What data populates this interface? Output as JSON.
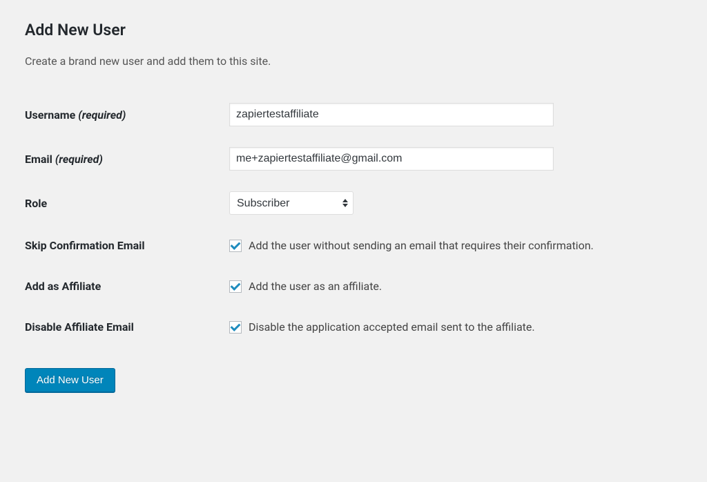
{
  "heading": "Add New User",
  "subheading": "Create a brand new user and add them to this site.",
  "fields": {
    "username": {
      "label": "Username",
      "required_text": "(required)",
      "value": "zapiertestaffiliate"
    },
    "email": {
      "label": "Email",
      "required_text": "(required)",
      "value": "me+zapiertestaffiliate@gmail.com"
    },
    "role": {
      "label": "Role",
      "selected": "Subscriber"
    },
    "skip_confirmation": {
      "label": "Skip Confirmation Email",
      "description": "Add the user without sending an email that requires their confirmation.",
      "checked": true
    },
    "add_affiliate": {
      "label": "Add as Affiliate",
      "description": "Add the user as an affiliate.",
      "checked": true
    },
    "disable_affiliate_email": {
      "label": "Disable Affiliate Email",
      "description": "Disable the application accepted email sent to the affiliate.",
      "checked": true
    }
  },
  "submit_label": "Add New User"
}
